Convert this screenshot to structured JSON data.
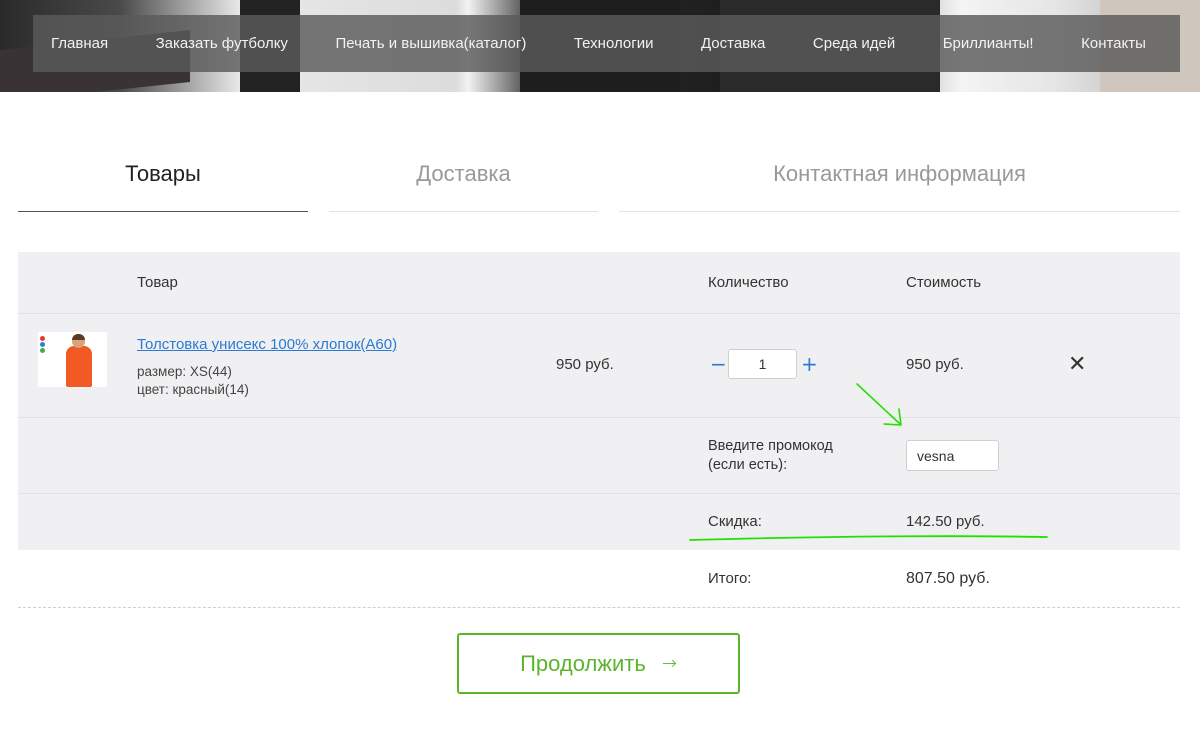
{
  "nav": {
    "items": [
      "Главная",
      "Заказать футболку",
      "Печать и вышивка(каталог)",
      "Технологии",
      "Доставка",
      "Среда идей",
      "Бриллианты!",
      "Контакты"
    ]
  },
  "steps": {
    "goods": "Товары",
    "delivery": "Доставка",
    "contact": "Контактная информация"
  },
  "table": {
    "headers": {
      "product": "Товар",
      "quantity": "Количество",
      "cost": "Стоимость"
    },
    "item": {
      "name": "Толстовка унисекс 100% хлопок(A60)",
      "size": "размер: XS(44)",
      "color": "цвет: красный(14)",
      "price": "950 руб.",
      "quantity": "1",
      "cost": "950 руб.",
      "minus": "−",
      "plus": "+",
      "remove": "✕"
    },
    "promo": {
      "label_line1": "Введите промокод",
      "label_line2": "(если есть):",
      "value": "vesna"
    },
    "discount": {
      "label": "Скидка:",
      "value": "142.50 руб."
    },
    "total": {
      "label": "Итого:",
      "value": "807.50 руб."
    }
  },
  "continue_button": {
    "label": "Продолжить",
    "arrow": "→"
  },
  "colors": {
    "accent_green": "#5ab52b",
    "link_blue": "#2a7ad4",
    "annotation_green": "#22e000"
  }
}
